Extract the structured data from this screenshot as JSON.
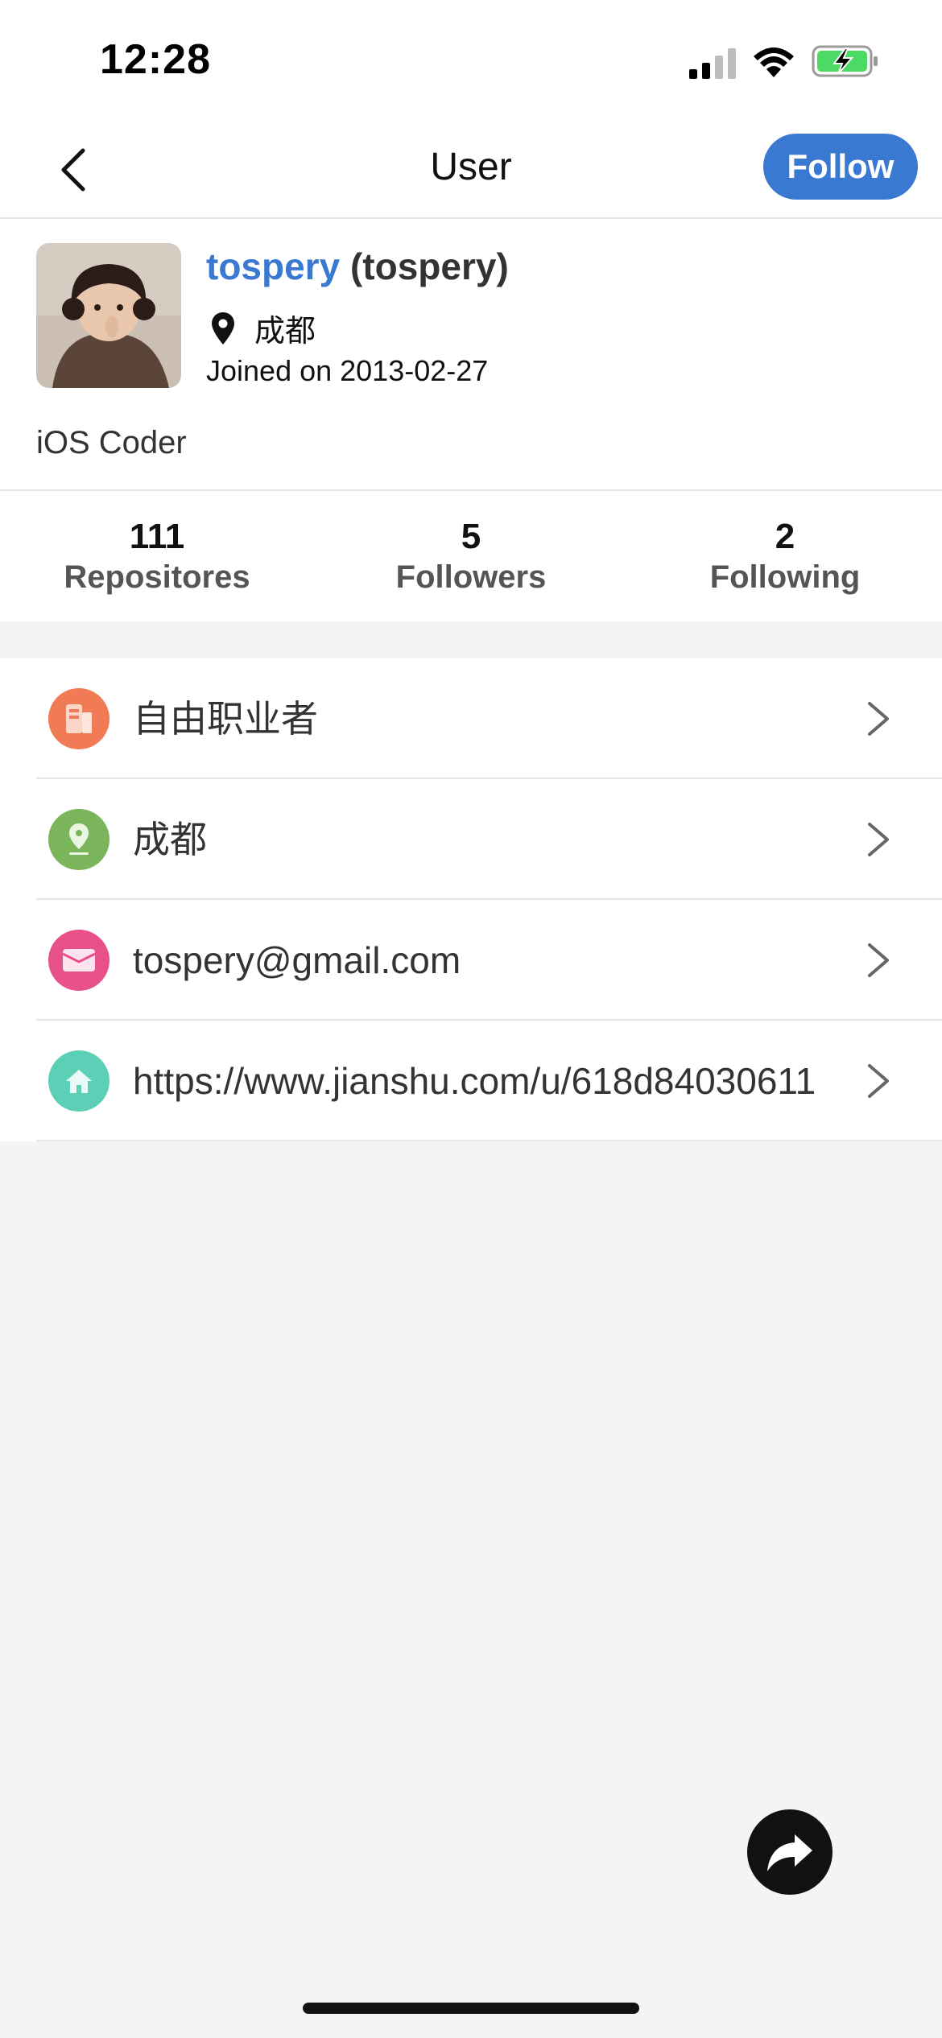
{
  "status_bar": {
    "time": "12:28",
    "icons": [
      "cellular-signal-icon",
      "wifi-icon",
      "battery-charging-icon"
    ],
    "battery_color": "#4cd964"
  },
  "nav": {
    "title": "User",
    "back_icon": "chevron-left-icon",
    "follow_label": "Follow"
  },
  "profile": {
    "login": "tospery",
    "name": "(tospery)",
    "location": "成都",
    "joined": "Joined on 2013-02-27",
    "bio": "iOS Coder"
  },
  "stats": [
    {
      "value": "111",
      "label": "Repositores"
    },
    {
      "value": "5",
      "label": "Followers"
    },
    {
      "value": "2",
      "label": "Following"
    }
  ],
  "info_rows": [
    {
      "icon": "company-icon",
      "color": "#f07b55",
      "text": "自由职业者"
    },
    {
      "icon": "location-pin-icon",
      "color": "#7ab55c",
      "text": "成都"
    },
    {
      "icon": "email-icon",
      "color": "#e8508a",
      "text": "tospery@gmail.com"
    },
    {
      "icon": "home-icon",
      "color": "#5ccfb7",
      "text": "https://www.jianshu.com/u/618d84030611"
    }
  ],
  "colors": {
    "accent": "#3a79d1",
    "background": "#f4f4f4"
  },
  "fab": {
    "icon": "share-icon"
  }
}
